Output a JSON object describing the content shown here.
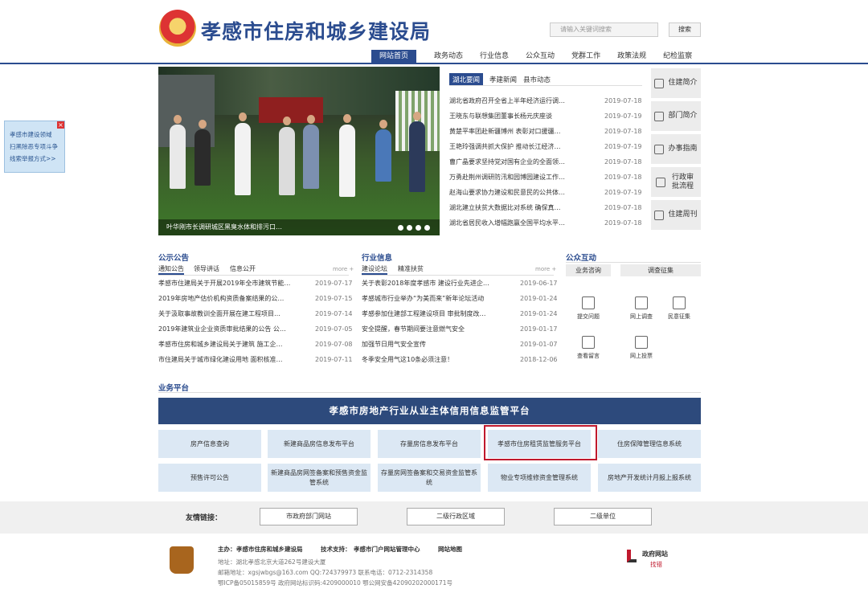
{
  "header": {
    "site_title": "孝感市住房和城乡建设局",
    "search_placeholder": "请输入关键词搜索",
    "search_button": "搜索"
  },
  "nav": [
    "网站首页",
    "政务动态",
    "行业信息",
    "公众互动",
    "党群工作",
    "政策法规",
    "纪检监察"
  ],
  "float_ad": {
    "lines": [
      "孝感市建设领域",
      "扫黑除恶专项斗争",
      "线索举报方式>>"
    ],
    "close": "×"
  },
  "banner": {
    "caption": "叶华刚市长调研城区黑臭水体和排污口…",
    "slides": 4
  },
  "news": {
    "tabs": [
      "湖北要闻",
      "孝建新闻",
      "县市动态"
    ],
    "items": [
      {
        "title": "湖北省政府召开全省上半年经济运行调…",
        "date": "2019-07-18"
      },
      {
        "title": "王晓东与联想集团董事长杨元庆座谈",
        "date": "2019-07-19"
      },
      {
        "title": "黄楚平率团赴新疆博州 表彰对口援疆…",
        "date": "2019-07-18"
      },
      {
        "title": "王艳玲强调共抓大保护 推动长江经济…",
        "date": "2019-07-19"
      },
      {
        "title": "曹广晶要求坚持党对国有企业的全面领…",
        "date": "2019-07-18"
      },
      {
        "title": "万勇赴荆州调研防汛和园博园建设工作…",
        "date": "2019-07-18"
      },
      {
        "title": "赵海山要求协力建设和民意民的公共体…",
        "date": "2019-07-19"
      },
      {
        "title": "湖北建立扶贫大数据比对系统 确保真…",
        "date": "2019-07-18"
      },
      {
        "title": "湖北省居民收入增幅跑赢全国平均水平…",
        "date": "2019-07-18"
      }
    ]
  },
  "sidebar": [
    "住建简介",
    "部门简介",
    "办事指南",
    "行政审批流程",
    "住建周刊"
  ],
  "notice": {
    "title": "公示公告",
    "tabs": [
      "通知公告",
      "领导讲话",
      "信息公开"
    ],
    "more": "more +",
    "items": [
      {
        "title": "孝感市住建局关于开展2019年全市建筑节能…",
        "date": "2019-07-17"
      },
      {
        "title": "2019年房地产估价机构资质备案结果的公…",
        "date": "2019-07-15"
      },
      {
        "title": "关于汲取事故教训全面开展在建工程项目…",
        "date": "2019-07-14"
      },
      {
        "title": "2019年建筑业企业资质审批结果的公告 公…",
        "date": "2019-07-05"
      },
      {
        "title": "孝感市住房和城乡建设局关于建筑 施工企…",
        "date": "2019-07-08"
      },
      {
        "title": "市住建局关于城市绿化建设用地 面积核准…",
        "date": "2019-07-11"
      }
    ]
  },
  "industry": {
    "title": "行业信息",
    "tabs": [
      "建设论坛",
      "精准扶贫"
    ],
    "more": "more +",
    "items": [
      {
        "title": "关于表彰2018年度孝感市 建设行业先进企…",
        "date": "2019-06-17"
      },
      {
        "title": "孝感城市行业举办“为美而来”新年论坛活动",
        "date": "2019-01-24"
      },
      {
        "title": "孝感参加住建部工程建设项目 审批制度改…",
        "date": "2019-01-24"
      },
      {
        "title": "安全提醒，春节期间要注意燃气安全",
        "date": "2019-01-17"
      },
      {
        "title": "加强节日用气安全宣传",
        "date": "2019-01-07"
      },
      {
        "title": "冬季安全用气这10条必须注意！",
        "date": "2018-12-06"
      }
    ]
  },
  "public": {
    "title": "公众互动",
    "tabs": [
      "业务咨询",
      "调查征集"
    ],
    "items": [
      "提交问题",
      "网上调查",
      "民意征集",
      "查看留言",
      "网上投票"
    ]
  },
  "platform": {
    "section_title": "业务平台",
    "banner": "孝感市房地产行业从业主体信用信息监管平台",
    "row1": [
      "房产信息查询",
      "新建商品房信息发布平台",
      "存量房信息发布平台",
      "孝感市住房租赁监管服务平台",
      "住房保障管理信息系统"
    ],
    "row2": [
      "预售许可公告",
      "新建商品房网签备案和预售资金监管系统",
      "存量房网签备案和交易资金监管系统",
      "物业专项维修资金管理系统",
      "房地产开发统计月报上报系统"
    ]
  },
  "links": {
    "label": "友情链接：",
    "buttons": [
      "市政府部门网站",
      "二级行政区域",
      "二级单位"
    ]
  },
  "footer": {
    "host_label": "主办：",
    "host": "孝感市住房和城乡建设局",
    "tech_label": "技术支持：",
    "tech": "孝感市门户网站管理中心",
    "sitemap": "网站地图",
    "address": "地址：湖北孝感北京大道262号建设大厦",
    "contact": "邮箱地址：xgsjwbgs@163.com  QQ:724379973  联系电话：0712-2314358",
    "icp": "鄂ICP备05015859号  政府网站标识码:4209000010  鄂公网安备42090202000171号",
    "gov_line1": "政府网站",
    "gov_line2": "找错"
  },
  "colors": {
    "primary": "#2b4c8f",
    "platform": "#2d4a7c",
    "highlight": "#c0192d",
    "cell": "#dce8f4"
  }
}
